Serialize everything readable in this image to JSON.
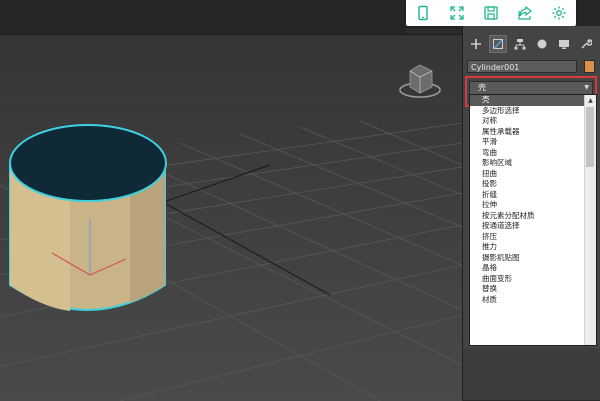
{
  "toolbar": {
    "buttons": [
      {
        "icon": "tablet-icon"
      },
      {
        "icon": "fullscreen-icon"
      },
      {
        "icon": "save-icon"
      },
      {
        "icon": "share-icon"
      },
      {
        "icon": "settings-icon"
      }
    ],
    "icon_color": "#1fb58f"
  },
  "command_panel": {
    "tabs": [
      "create-icon",
      "modify-icon",
      "hierarchy-icon",
      "motion-icon",
      "display-icon",
      "utilities-icon"
    ],
    "object_name": "Cylinder001",
    "object_color": "#d8924b",
    "modifier_list": {
      "selected": "壳",
      "items": [
        "壳",
        "多边形选择",
        "对称",
        "属性承载器",
        "平滑",
        "弯曲",
        "影响区域",
        "扭曲",
        "投影",
        "折缝",
        "拉伸",
        "按元素分配材质",
        "按通道选择",
        "挤压",
        "推力",
        "摄影机贴图",
        "晶格",
        "曲面变形",
        "替换",
        "材质"
      ]
    }
  },
  "viewport": {
    "object": "cylinder",
    "highlight_color": "#3fd0e0",
    "cylinder_color": "#c9b487"
  }
}
